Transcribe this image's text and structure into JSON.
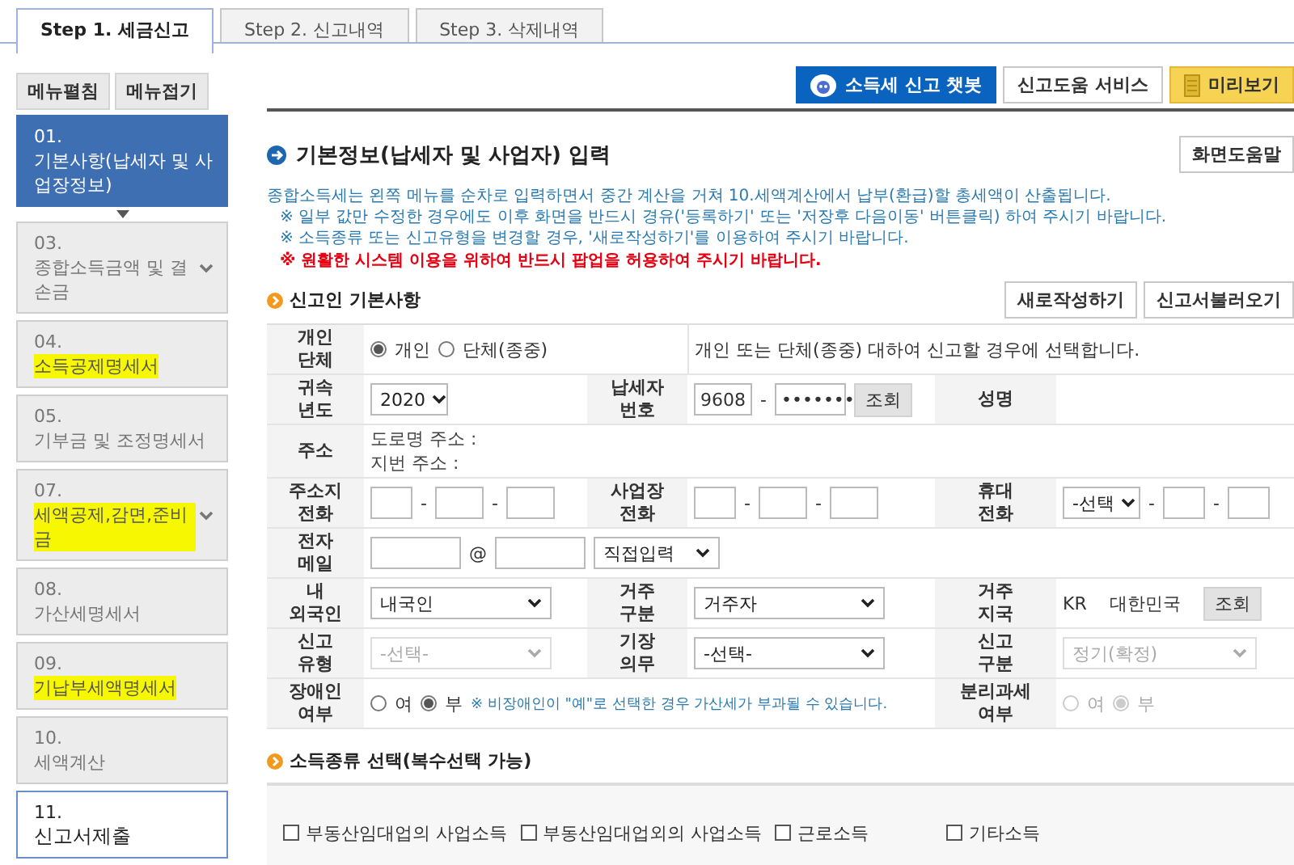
{
  "tabs": [
    {
      "label": "Step 1. 세금신고",
      "selected": true
    },
    {
      "label": "Step 2. 신고내역",
      "selected": false
    },
    {
      "label": "Step 3. 삭제내역",
      "selected": false
    }
  ],
  "menu_buttons": [
    "메뉴펼침",
    "메뉴접기"
  ],
  "sidebar": {
    "items": [
      {
        "number": "01.",
        "label": "기본사항(납세자 및 사업장정보)",
        "selected": true,
        "kind": "step",
        "highlighted": false,
        "submenu": false
      },
      {
        "number": "03.",
        "label": "종합소득금액 및 결손금",
        "selected": false,
        "kind": "step",
        "highlighted": false,
        "submenu": true
      },
      {
        "number": "04.",
        "label": "소득공제명세서",
        "selected": false,
        "kind": "step",
        "highlighted": true,
        "submenu": false
      },
      {
        "number": "05.",
        "label": "기부금 및 조정명세서",
        "selected": false,
        "kind": "step",
        "highlighted": false,
        "submenu": false
      },
      {
        "number": "07.",
        "label": "세액공제,감면,준비금",
        "selected": false,
        "kind": "step",
        "highlighted": true,
        "submenu": true
      },
      {
        "number": "08.",
        "label": "가산세명세서",
        "selected": false,
        "kind": "step",
        "highlighted": false,
        "submenu": false
      },
      {
        "number": "09.",
        "label": "기납부세액명세서",
        "selected": false,
        "kind": "step",
        "highlighted": true,
        "submenu": false
      },
      {
        "number": "10.",
        "label": "세액계산",
        "selected": false,
        "kind": "step",
        "highlighted": false,
        "submenu": false
      },
      {
        "number": "11.",
        "label": "신고서제출",
        "selected": false,
        "kind": "final",
        "highlighted": false,
        "submenu": false
      }
    ]
  },
  "toolbar": [
    {
      "label": "소득세 신고 챗봇",
      "kind": "chatbot"
    },
    {
      "label": "신고도움 서비스",
      "kind": "plain"
    },
    {
      "label": "미리보기",
      "kind": "preview"
    }
  ],
  "page_title": "기본정보(납세자 및 사업자) 입력",
  "help_button": "화면도움말",
  "notices": [
    {
      "text": "종합소득세는 왼쪽 메뉴를 순차로 입력하면서 중간 계산을 거쳐 10.세액계산에서 납부(환급)할 총세액이 산출됩니다.",
      "kind": "intro"
    },
    {
      "text": "※ 일부 값만 수정한 경우에도 이후 화면을 반드시 경유('등록하기' 또는 '저장후 다음이동' 버튼클릭) 하여 주시기 바랍니다.",
      "kind": "note"
    },
    {
      "text": "※ 소득종류 또는 신고유형을 변경할 경우, '새로작성하기'를 이용하여 주시기 바랍니다.",
      "kind": "note"
    },
    {
      "text": "※ 원활한 시스템 이용을 위하여 반드시 팝업을 허용하여 주시기 바랍니다.",
      "kind": "warning"
    }
  ],
  "section_title": "신고인 기본사항",
  "section_buttons": [
    "새로작성하기",
    "신고서불러오기"
  ],
  "form": {
    "separator": "-",
    "entity": {
      "label": "개인\n단체",
      "options": [
        {
          "label": "개인",
          "selected": true
        },
        {
          "label": "단체(종중)",
          "selected": false
        }
      ],
      "description": "개인 또는 단체(종중) 대하여 신고할 경우에 선택합니다."
    },
    "year": {
      "label": "귀속\n년도",
      "value": "2020"
    },
    "taxpayer_id": {
      "label": "납세자\n번호",
      "part_1": "9608",
      "part_2": "•••••••",
      "button": "조회"
    },
    "name": {
      "label": "성명"
    },
    "address": {
      "label": "주소",
      "road": "도로명 주소 :",
      "lot": "지번 주소 :"
    },
    "home_phone": {
      "label": "주소지\n전화"
    },
    "business_phone": {
      "label": "사업장\n전화"
    },
    "mobile": {
      "label": "휴대\n전화",
      "prefix": "-선택"
    },
    "email": {
      "label": "전자\n메일",
      "at": "@",
      "domain": "직접입력"
    },
    "nationality": {
      "label": "내\n외국인",
      "value": "내국인"
    },
    "residency": {
      "label": "거주\n구분",
      "value": "거주자"
    },
    "country": {
      "label": "거주\n지국",
      "code": "KR",
      "name": "대한민국",
      "button": "조회"
    },
    "report_type": {
      "label": "신고\n유형",
      "value": "-선택-",
      "disabled": true
    },
    "bookkeeping": {
      "label": "기장\n의무",
      "value": "-선택-",
      "disabled": false
    },
    "report_class": {
      "label": "신고\n구분",
      "value": "정기(확정)",
      "disabled": true
    },
    "disabled_person": {
      "label": "장애인\n여부",
      "options": [
        {
          "label": "여",
          "selected": false
        },
        {
          "label": "부",
          "selected": true
        }
      ],
      "note": "※ 비장애인이 \"예\"로 선택한 경우 가산세가 부과될 수 있습니다.",
      "disabled": false
    },
    "separate_tax": {
      "label": "분리과세\n여부",
      "options": [
        {
          "label": "여",
          "selected": false
        },
        {
          "label": "부",
          "selected": true
        }
      ],
      "disabled": true
    }
  },
  "income_section": {
    "title": "소득종류 선택(복수선택 가능)",
    "options": [
      {
        "label": "부동산임대업의 사업소득",
        "checked": false
      },
      {
        "label": "부동산임대업외의 사업소득",
        "checked": false
      },
      {
        "label": "근로소득",
        "checked": false
      },
      {
        "label": "기타소득",
        "checked": false
      }
    ]
  }
}
